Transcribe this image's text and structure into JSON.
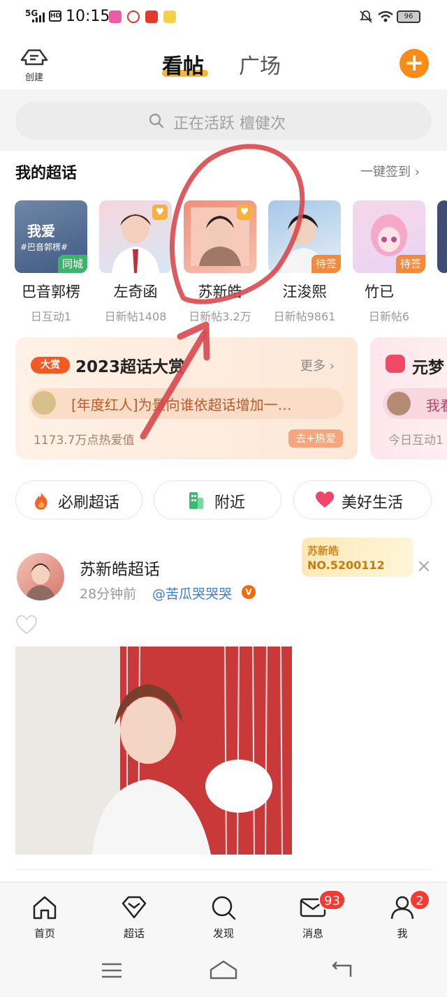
{
  "status_bar": {
    "network": "5G",
    "hd": "HD",
    "time": "10:15",
    "battery": "96"
  },
  "header": {
    "create_label": "创建",
    "tab_active": "看帖",
    "tab_inactive": "广场"
  },
  "search": {
    "placeholder": "正在活跃 檀健次"
  },
  "my_topics": {
    "title": "我的超话",
    "checkin_all": "一键签到 ›",
    "items": [
      {
        "name": "巴音郭楞",
        "stat": "日互动1",
        "badge": "同城",
        "badge_color": "#3fb36b",
        "tile_text": "我爱",
        "tile_sub": "#巴音郭楞#"
      },
      {
        "name": "左奇函",
        "stat": "日新帖1408",
        "badge": "",
        "badge_color": ""
      },
      {
        "name": "苏新皓",
        "stat": "日新帖3.2万",
        "badge": "",
        "badge_color": ""
      },
      {
        "name": "汪浚熙",
        "stat": "日新帖9861",
        "badge": "待签",
        "badge_color": "#f08a3c"
      },
      {
        "name": "竹已",
        "stat": "日新帖6",
        "badge": "待签",
        "badge_color": "#f08a3c"
      }
    ]
  },
  "award_card": {
    "tag": "大赏",
    "title": "2023超话大赏",
    "more": "更多 ›",
    "row_text": "[年度红人]为景向谁依超话增加一…",
    "score": "1173.7万点热爱值",
    "boost": "去+热爱"
  },
  "second_card": {
    "title": "元梦",
    "row_text": "我看",
    "stat": "今日互动1"
  },
  "pills": [
    {
      "label": "必刷超话",
      "icon": "fire-icon"
    },
    {
      "label": "附近",
      "icon": "building-icon"
    },
    {
      "label": "美好生活",
      "icon": "heart-icon"
    }
  ],
  "post": {
    "topic_name": "苏新皓超话",
    "time": "28分钟前",
    "user": "@苦瓜哭哭哭",
    "fan_badge_name": "苏新皓",
    "fan_badge_no": "NO.5200112",
    "close": "×"
  },
  "bottom_nav": [
    {
      "label": "首页",
      "icon": "home-icon",
      "badge": ""
    },
    {
      "label": "超话",
      "icon": "diamond-icon",
      "badge": ""
    },
    {
      "label": "发现",
      "icon": "search-icon",
      "badge": ""
    },
    {
      "label": "消息",
      "icon": "mail-icon",
      "badge": "93"
    },
    {
      "label": "我",
      "icon": "user-icon",
      "badge": "2"
    }
  ],
  "colors": {
    "accent": "#fa8c16",
    "tab_underline": "#f7b731",
    "annotation_red": "#d9484c",
    "link_blue": "#3d7bd9"
  }
}
